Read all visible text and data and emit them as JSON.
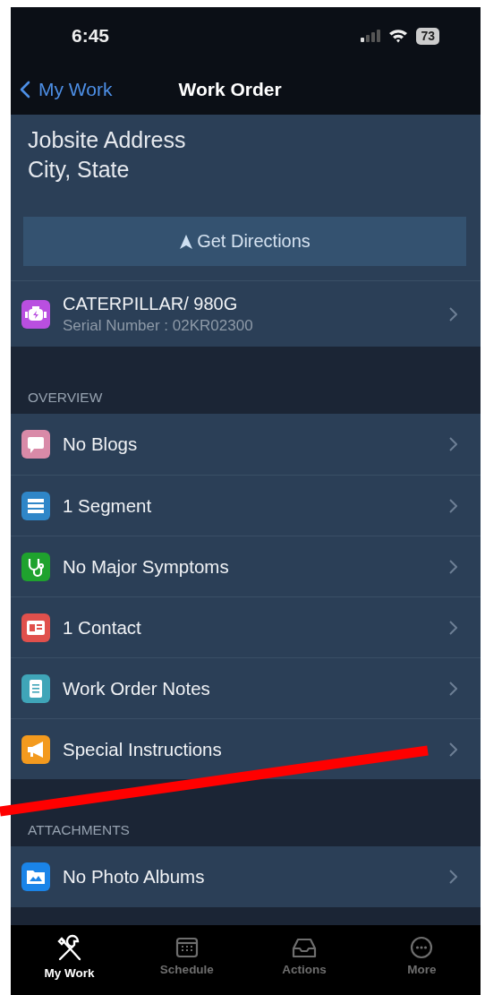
{
  "status_bar": {
    "time": "6:45",
    "battery": "73"
  },
  "nav": {
    "back": "My Work",
    "title": "Work Order"
  },
  "address": {
    "line1": "Jobsite Address",
    "line2": "City, State",
    "button": "Get Directions"
  },
  "equipment": {
    "title": "CATERPILLAR/ 980G",
    "subtitle": "Serial Number : 02KR02300",
    "color": "#b94fe0"
  },
  "sections": [
    {
      "header": "OVERVIEW",
      "items": [
        {
          "label": "No Blogs",
          "color": "#d98aa8"
        },
        {
          "label": "1 Segment",
          "color": "#2f86c8"
        },
        {
          "label": "No Major Symptoms",
          "color": "#1fa22e"
        },
        {
          "label": "1 Contact",
          "color": "#e0504c"
        },
        {
          "label": "Work Order Notes",
          "color": "#3fa5b8"
        },
        {
          "label": "Special Instructions",
          "color": "#f39a1e"
        }
      ]
    },
    {
      "header": "ATTACHMENTS",
      "items": [
        {
          "label": "No Photo Albums",
          "color": "#1a84e8"
        }
      ]
    }
  ],
  "tabs": [
    {
      "label": "My Work",
      "selected": true
    },
    {
      "label": "Schedule",
      "selected": false
    },
    {
      "label": "Actions",
      "selected": false
    },
    {
      "label": "More",
      "selected": false
    }
  ]
}
